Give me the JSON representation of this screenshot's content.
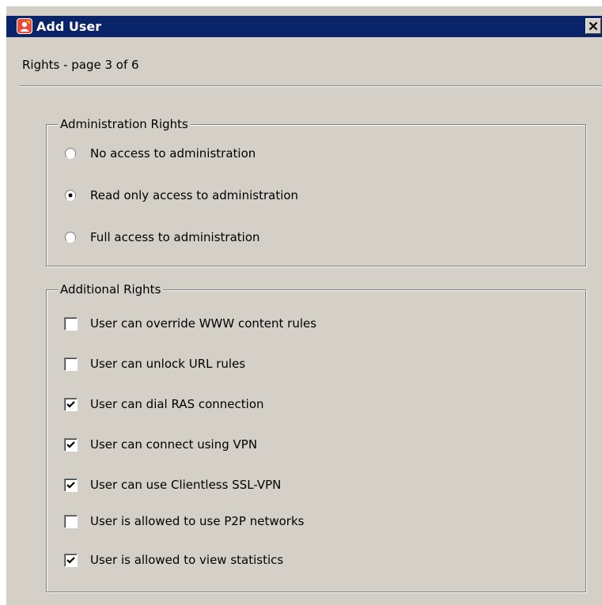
{
  "window": {
    "title": "Add User",
    "icon": "app-logo-icon",
    "close_icon": "close-icon"
  },
  "page_heading": "Rights - page 3 of 6",
  "admin_rights": {
    "legend": "Administration Rights",
    "options": [
      {
        "label": "No access to administration",
        "selected": false
      },
      {
        "label": "Read only access to administration",
        "selected": true
      },
      {
        "label": "Full access to administration",
        "selected": false
      }
    ]
  },
  "additional_rights": {
    "legend": "Additional Rights",
    "items": [
      {
        "label": "User can override WWW content rules",
        "checked": false
      },
      {
        "label": "User can unlock URL rules",
        "checked": false
      },
      {
        "label": "User can dial RAS connection",
        "checked": true
      },
      {
        "label": "User can connect using VPN",
        "checked": true
      },
      {
        "label": "User can use Clientless SSL-VPN",
        "checked": true
      },
      {
        "label": "User is allowed to use P2P networks",
        "checked": false
      },
      {
        "label": "User is allowed to view statistics",
        "checked": true
      }
    ]
  },
  "colors": {
    "titlebar": "#0a246a",
    "dialog_background": "#d4d0c8",
    "icon_accent": "#e84a3a"
  }
}
